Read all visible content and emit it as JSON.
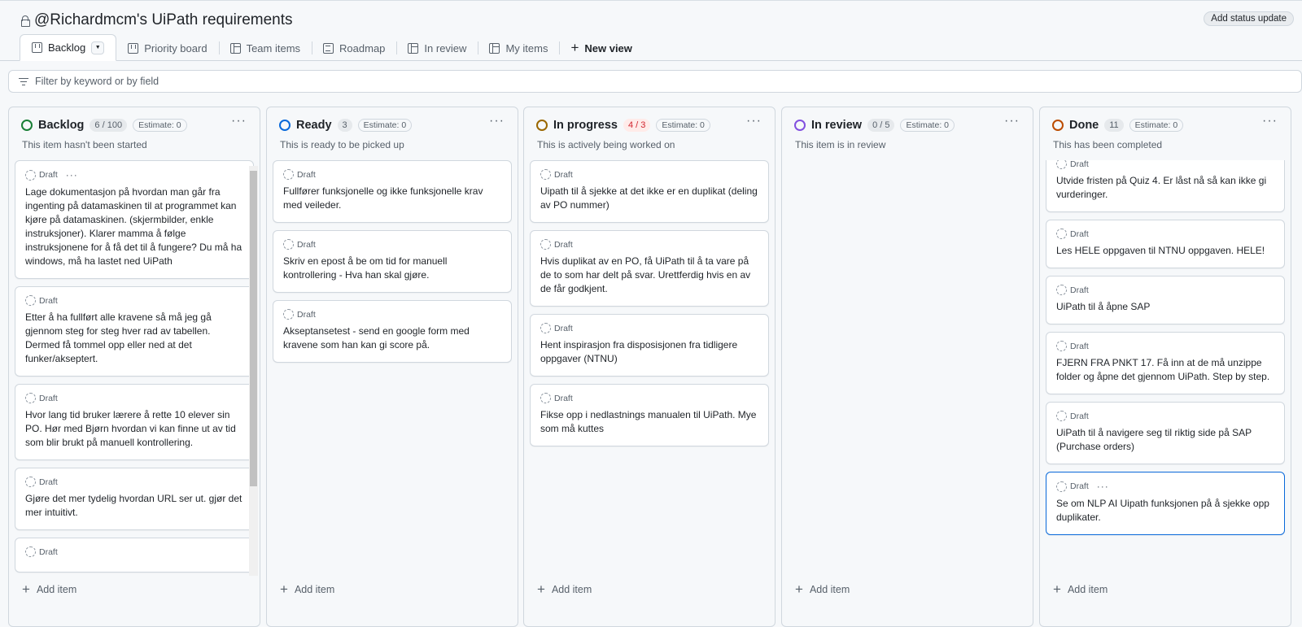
{
  "title": "@Richardmcm's UiPath requirements",
  "status_update": "Add status update",
  "tabs": [
    {
      "label": "Backlog",
      "icon": "board"
    },
    {
      "label": "Priority board",
      "icon": "board"
    },
    {
      "label": "Team items",
      "icon": "table"
    },
    {
      "label": "Roadmap",
      "icon": "roadmap"
    },
    {
      "label": "In review",
      "icon": "table"
    },
    {
      "label": "My items",
      "icon": "table"
    }
  ],
  "new_view": "New view",
  "filter_placeholder": "Filter by keyword or by field",
  "add_item": "Add item",
  "draft": "Draft",
  "columns": [
    {
      "name": "Backlog",
      "count": "6 / 100",
      "estimate": "Estimate: 0",
      "desc": "This item hasn't been started",
      "color": "#1a7f37",
      "cards": [
        "Lage dokumentasjon på hvordan man går fra ingenting på datamaskinen til at programmet kan kjøre på datamaskinen. (skjermbilder, enkle instruksjoner). Klarer mamma å følge instruksjonene for å få det til å fungere? Du må ha windows, må ha lastet ned UiPath",
        "Etter å ha fullført alle kravene så må jeg gå gjennom steg for steg hver rad av tabellen. Dermed få tommel opp eller ned at det funker/akseptert.",
        "Hvor lang tid bruker lærere å rette 10 elever sin PO. Hør med Bjørn hvordan vi kan finne ut av tid som blir brukt på manuell kontrollering.",
        "Gjøre det mer tydelig hvordan URL ser ut. gjør det mer intuitivt.",
        ""
      ]
    },
    {
      "name": "Ready",
      "count": "3",
      "estimate": "Estimate: 0",
      "desc": "This is ready to be picked up",
      "color": "#0969da",
      "cards": [
        "Fullfører funksjonelle og ikke funksjonelle krav med veileder.",
        "Skriv en epost å be om tid for manuell kontrollering - Hva han skal gjøre.",
        "Akseptansetest - send en google form med kravene som han kan gi score på."
      ]
    },
    {
      "name": "In progress",
      "count": "4 / 3",
      "estimate": "Estimate: 0",
      "desc": "This is actively being worked on",
      "color": "#9a6700",
      "over_limit": true,
      "cards": [
        "Uipath til å sjekke at det ikke er en duplikat (deling av PO nummer)",
        "Hvis duplikat av en PO, få UiPath til å ta vare på de to som har delt på svar. Urettferdig hvis en av de får godkjent.",
        "Hent inspirasjon fra disposisjonen fra tidligere oppgaver (NTNU)",
        "Fikse opp i nedlastnings manualen til UiPath. Mye som må kuttes"
      ]
    },
    {
      "name": "In review",
      "count": "0 / 5",
      "estimate": "Estimate: 0",
      "desc": "This item is in review",
      "color": "#8250df",
      "cards": []
    },
    {
      "name": "Done",
      "count": "11",
      "estimate": "Estimate: 0",
      "desc": "This has been completed",
      "color": "#bc4c00",
      "cards": [
        "Utvide fristen på Quiz 4. Er låst nå så kan ikke gi vurderinger.",
        "Les HELE oppgaven til NTNU oppgaven. HELE!",
        "UiPath til å åpne SAP",
        "FJERN FRA PNKT 17. Få inn at de må unzippe folder og åpne det gjennom UiPath. Step by step.",
        "UiPath til å navigere seg til riktig side på SAP (Purchase orders)",
        "Se om NLP AI Uipath funksjonen på å sjekke opp duplikater."
      ]
    }
  ]
}
